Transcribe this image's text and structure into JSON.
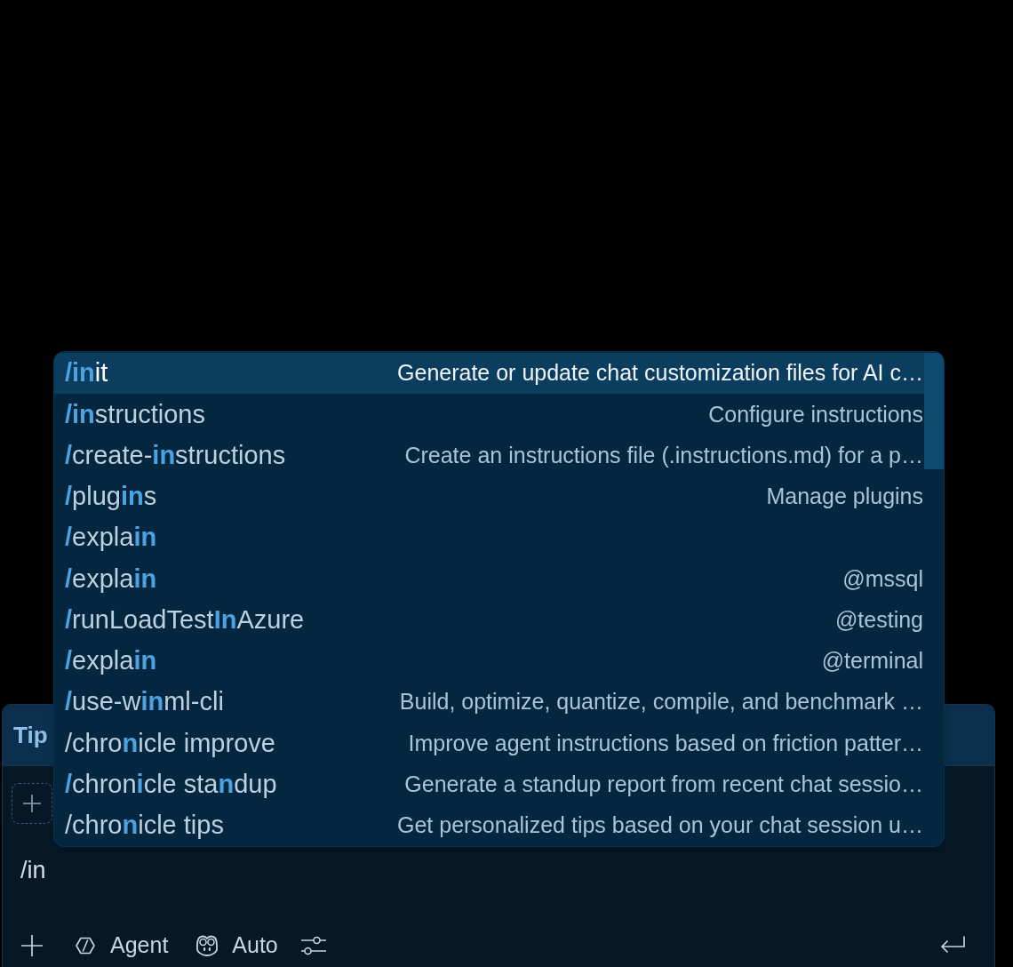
{
  "slash_menu": {
    "items": [
      {
        "label": "**/in**it",
        "description": "Generate or update chat customization files for AI c…",
        "selected": true
      },
      {
        "label": "**/in**structions",
        "description": "Configure instructions",
        "selected": false
      },
      {
        "label": "**/**create-**in**structions",
        "description": "Create an instructions file (.instructions.md) for a p…",
        "selected": false
      },
      {
        "label": "**/**plug**in**s",
        "description": "Manage plugins",
        "selected": false
      },
      {
        "label": "**/**expla**in**",
        "selected": false
      },
      {
        "label": "**/**expla**in**",
        "description": "@mssql",
        "selected": false
      },
      {
        "label": "**/**runLoadTest**In**Azure",
        "description": "@testing",
        "selected": false
      },
      {
        "label": "**/**expla**in**",
        "description": "@terminal",
        "selected": false
      },
      {
        "label": "**/**use-w**in**ml-cli",
        "description": "Build, optimize, quantize, compile, and benchmark …",
        "selected": false
      },
      {
        "label": "/chro**n**icle improve",
        "description": "Improve agent instructions based on friction patter…",
        "selected": false
      },
      {
        "label": "**/**chron**i**cle sta**n**dup",
        "description": "Generate a standup report from recent chat sessio…",
        "selected": false
      },
      {
        "label": "/chro**n**icle tips",
        "description": "Get personalized tips based on your chat session u…",
        "selected": false
      }
    ]
  },
  "chat_panel": {
    "tip_banner": {
      "text": "Tip"
    },
    "input": {
      "value": "/in"
    },
    "toolbar": {
      "agent_mode": "Agent",
      "model": "Auto"
    }
  }
}
